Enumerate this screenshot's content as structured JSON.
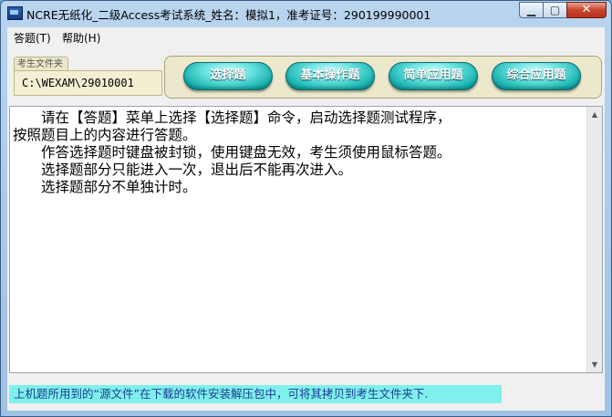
{
  "window": {
    "title": "NCRE无纸化_二级Access考试系统_姓名：模拟1，准考证号：290199990001",
    "controls": {
      "minimize": "▁",
      "maximize": "▢",
      "close": "✕"
    }
  },
  "menu": {
    "items": [
      {
        "label": "答题(T)"
      },
      {
        "label": "帮助(H)"
      }
    ]
  },
  "folder": {
    "tab_label": "考生文件夹",
    "path": "C:\\WEXAM\\29010001"
  },
  "toolbar": {
    "buttons": [
      {
        "label": "选择题"
      },
      {
        "label": "基本操作题"
      },
      {
        "label": "简单应用题"
      },
      {
        "label": "综合应用题"
      }
    ]
  },
  "content": {
    "lines": [
      "　　请在【答题】菜单上选择【选择题】命令，启动选择题测试程序，",
      "按照题目上的内容进行答题。",
      "　　作答选择题时键盘被封锁，使用键盘无效，考生须使用鼠标答题。",
      "　　选择题部分只能进入一次，退出后不能再次进入。",
      "　　选择题部分不单独计时。"
    ]
  },
  "footer": {
    "text": "上机题所用到的“源文件”在下载的软件安装解压包中，可将其拷贝到考生文件夹下."
  },
  "colors": {
    "button_accent": "#1ab3b1",
    "footer_bg": "#7ff0ec",
    "footer_text": "#1b3b93"
  }
}
